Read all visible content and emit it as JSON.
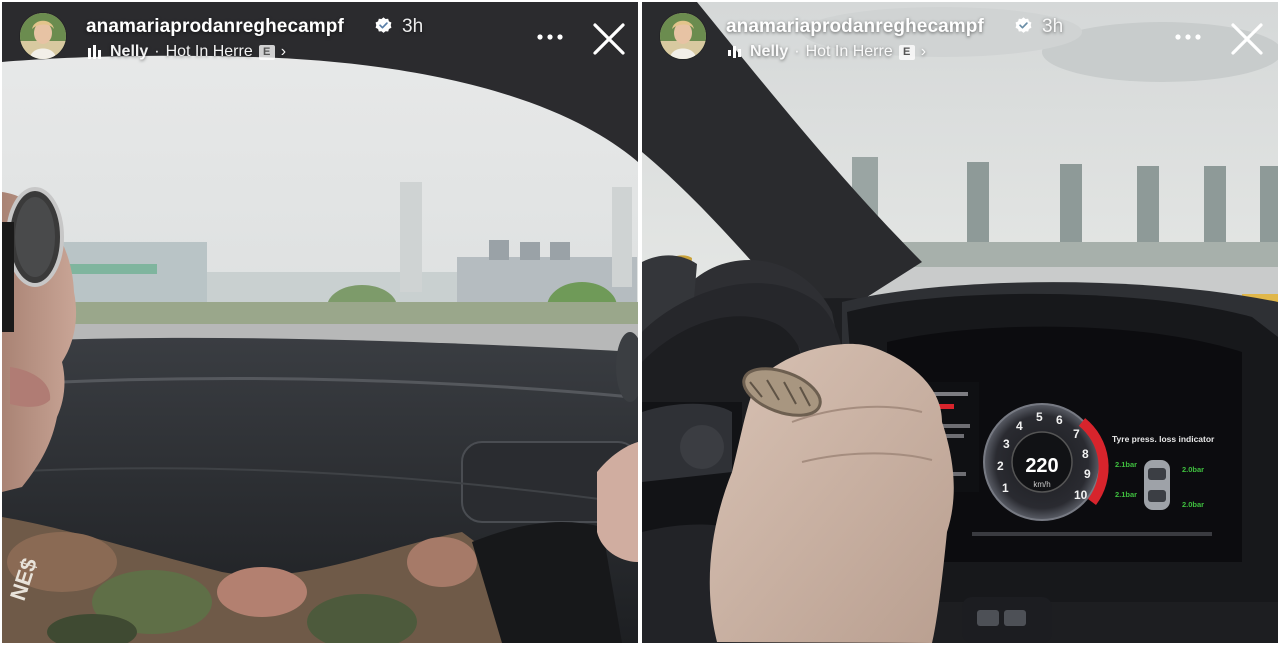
{
  "stories": [
    {
      "username": "anamariaprodanreghecampf",
      "time": "3h",
      "music": {
        "artist": "Nelly",
        "separator": "·",
        "song": "Hot In Herre",
        "explicit": "E",
        "chevron": "›"
      },
      "icons": {
        "verified": "verified-badge-icon",
        "sound": "audio-bars-icon",
        "more": "more-dots-icon",
        "close": "close-x-icon"
      },
      "scene": {
        "sweater_print": "NE$"
      }
    },
    {
      "username": "anamariaprodanreghecampf",
      "time": "3h",
      "music": {
        "artist": "Nelly",
        "separator": "·",
        "song": "Hot In Herre",
        "explicit": "E",
        "chevron": "›"
      },
      "icons": {
        "verified": "verified-badge-icon",
        "sound": "audio-bars-icon",
        "more": "more-dots-icon",
        "close": "close-x-icon"
      },
      "scene": {
        "speed": "220",
        "unit": "km/h",
        "panel_title": "Tyre press. loss indicator",
        "tyre_readings": [
          "2.1bar",
          "2.0bar",
          "2.1bar",
          "2.0bar"
        ],
        "gauge_numbers": [
          "1",
          "2",
          "3",
          "4",
          "5",
          "6",
          "7",
          "8",
          "9",
          "10"
        ]
      }
    }
  ],
  "colors": {
    "header_text": "#ffffff",
    "gauge_red": "#d8242c",
    "tyre_green": "#3fbf3f",
    "gear_yellow": "#c9a23a"
  }
}
